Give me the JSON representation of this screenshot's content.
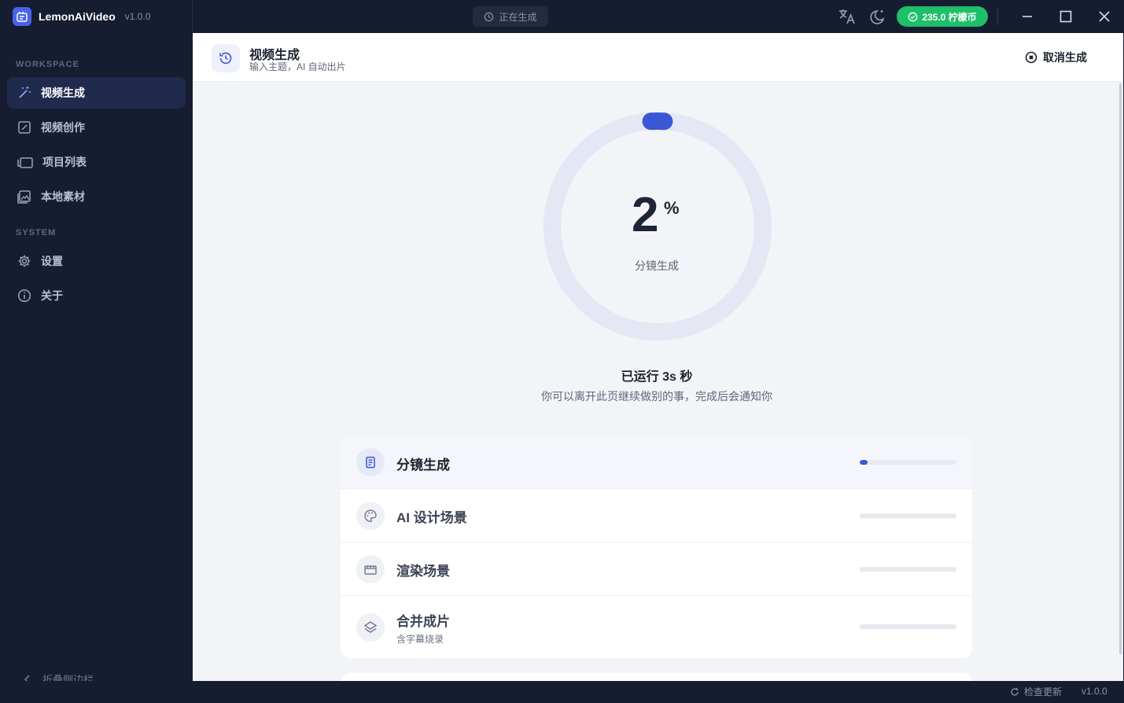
{
  "app": {
    "name": "LemonAiVideo",
    "version": "v1.0.0"
  },
  "titlebar": {
    "status_text": "正在生成",
    "credits": "235.0 柠檬币",
    "icons": [
      "clock-icon",
      "translate-icon",
      "moon-icon",
      "check-circle-icon",
      "minimize-icon",
      "maximize-icon",
      "close-icon"
    ]
  },
  "sidebar": {
    "workspace_label": "WORKSPACE",
    "system_label": "SYSTEM",
    "items": [
      {
        "label": "视频生成",
        "icon": "magic-wand-icon",
        "active": true
      },
      {
        "label": "视频创作",
        "icon": "edit-icon",
        "active": false
      },
      {
        "label": "项目列表",
        "icon": "folder-icon",
        "active": false
      },
      {
        "label": "本地素材",
        "icon": "image-icon",
        "active": false
      }
    ],
    "system_items": [
      {
        "label": "设置",
        "icon": "gear-icon"
      },
      {
        "label": "关于",
        "icon": "info-icon"
      }
    ],
    "collapse_label": "折叠侧边栏"
  },
  "header": {
    "title": "视频生成",
    "subtitle": "输入主题，AI 自动出片",
    "cancel_label": "取消生成"
  },
  "progress": {
    "percent": "2",
    "percent_sign": "%",
    "percent_value": 2,
    "stage": "分镜生成",
    "elapsed": "已运行 3s 秒",
    "notice": "你可以离开此页继续做别的事，完成后会通知你"
  },
  "steps": [
    {
      "title": "分镜生成",
      "subtitle": "",
      "icon": "document-icon",
      "progress": 0.08,
      "active": true
    },
    {
      "title": "AI 设计场景",
      "subtitle": "",
      "icon": "palette-icon",
      "progress": 0,
      "active": false
    },
    {
      "title": "渲染场景",
      "subtitle": "",
      "icon": "clapper-icon",
      "progress": 0,
      "active": false
    },
    {
      "title": "合并成片",
      "subtitle": "含字幕烧录",
      "icon": "layers-icon",
      "progress": 0,
      "active": false
    }
  ],
  "statusbar": {
    "check_update": "检查更新",
    "version": "v1.0.0"
  },
  "colors": {
    "accent": "#3b57d6",
    "credits_bg": "#1fbf6b",
    "sidebar_bg": "#161d30",
    "ring_track": "#e4e7f4"
  }
}
